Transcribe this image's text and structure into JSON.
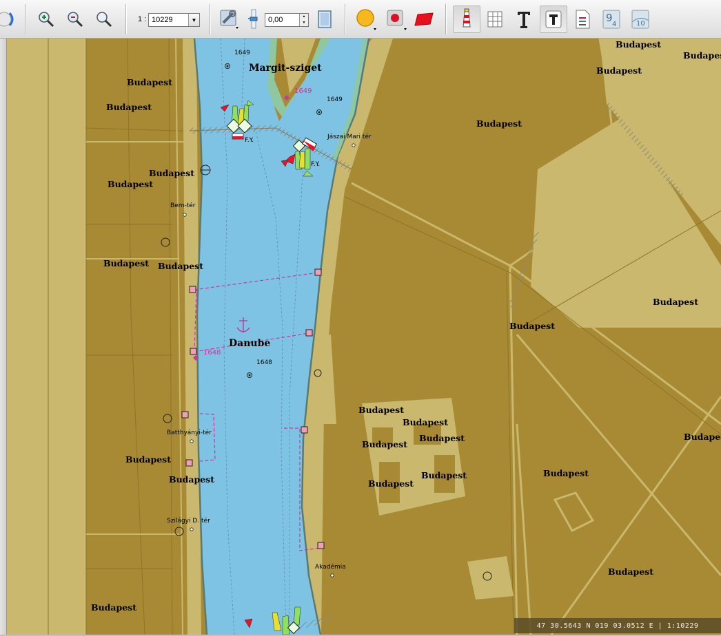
{
  "toolbar": {
    "scale_prefix": "1 :",
    "scale_value": "10229",
    "depth_value": "0,00",
    "icons": [
      "back-icon",
      "zoom-in-icon",
      "zoom-out-icon",
      "zoom-reset-icon",
      "tools-icon",
      "depth-slider-icon",
      "page-icon",
      "circle-icon",
      "record-icon",
      "rectangle-icon",
      "lighthouse-icon",
      "grid-icon",
      "text-tool-icon",
      "text-icon",
      "legend-icon",
      "sounding-icon",
      "contour-icon"
    ]
  },
  "map": {
    "colors": {
      "land_dark": "#a88a34",
      "land_light": "#c9b86e",
      "water": "#7fc3e4",
      "shore_green": "#8fc7a0",
      "route_magenta": "#c33aa0"
    },
    "labels": {
      "margit_sziget": "Margit-sziget",
      "danube": "Danube",
      "budapest": "Budapest",
      "bem_ter": "Bem-tér",
      "batthyanyi_ter": "Batthyányi-tér",
      "szilagyi_ter": "Szilágyi D. tér",
      "jaszai_mari_ter": "Jászai Mari tér",
      "akademia": "Akadémia",
      "fy": "F.Y.",
      "km_1649": "1649",
      "km_1648": "1648"
    }
  },
  "status": {
    "coordinates": "47 30.5643 N  019 03.0512 E | 1:10229"
  }
}
